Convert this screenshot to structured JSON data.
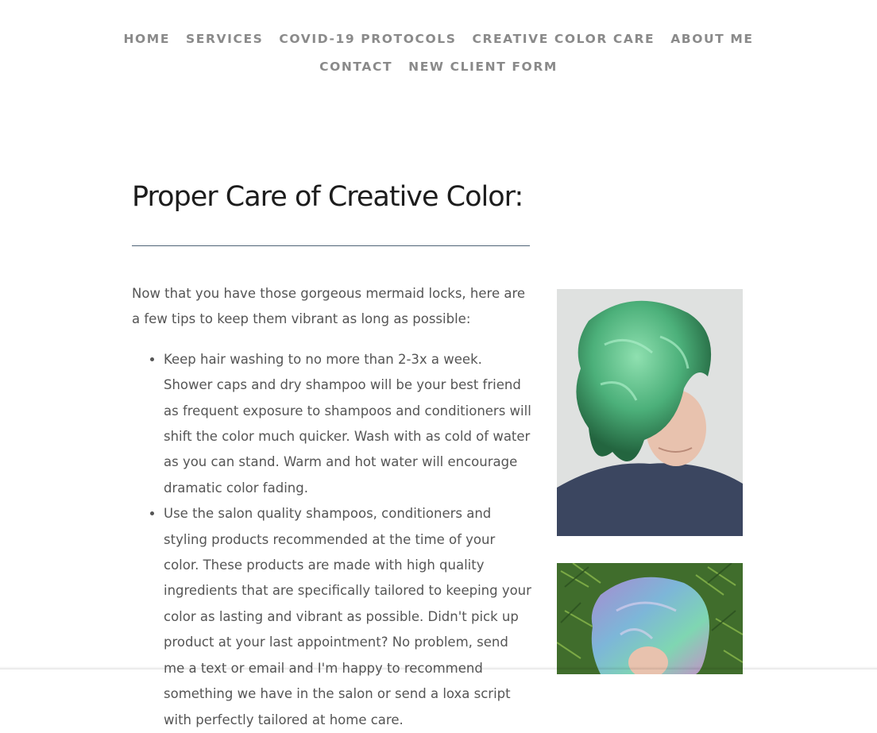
{
  "nav": {
    "row1": [
      "HOME",
      "SERVICES",
      "COVID-19 PROTOCOLS",
      "CREATIVE COLOR CARE",
      "ABOUT ME"
    ],
    "row2": [
      "CONTACT",
      "NEW CLIENT FORM"
    ]
  },
  "page": {
    "title": "Proper Care of Creative Color:",
    "intro": "Now that you have those gorgeous mermaid locks, here are a few tips to keep them vibrant as long as possible:",
    "bullets": [
      "Keep hair washing to no more than 2-3x a week. Shower caps and dry shampoo will be your best friend as frequent exposure to shampoos and conditioners will shift the color much quicker. Wash with as cold of water as you can stand. Warm and hot water will encourage dramatic color fading.",
      "Use the salon quality shampoos, conditioners and styling products recommended at the time of your color. These products are made with high quality ingredients that are specifically tailored to keeping your color as lasting and vibrant as possible. Didn't pick up product at your last appointment? No problem, send me a text or email and I'm happy to recommend something we have in the salon or send a loxa script with perfectly tailored at home care."
    ]
  },
  "colors": {
    "nav_text": "#8a8a8a",
    "rule": "#4f6377",
    "green_hair": "#5fbf86",
    "pastel_hair": "#8fa7d8"
  }
}
